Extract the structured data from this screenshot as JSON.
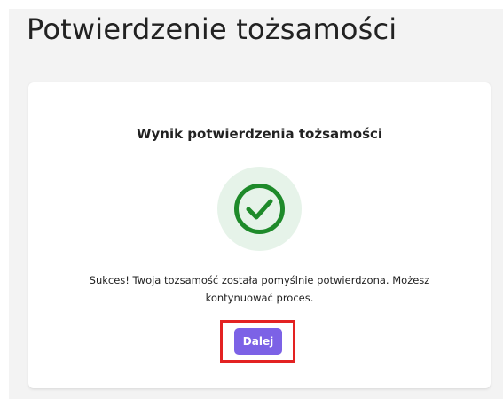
{
  "page": {
    "title": "Potwierdzenie tożsamości"
  },
  "card": {
    "title": "Wynik potwierdzenia tożsamości",
    "status_icon": "check-circle-icon",
    "message": "Sukces! Twoja tożsamość została pomyślnie potwierdzona. Możesz kontynuować proces.",
    "next_button_label": "Dalej"
  },
  "colors": {
    "success_green": "#1e8a2a",
    "success_circle_bg": "#e6f3e9",
    "button_purple": "#7c62e6",
    "highlight_red": "#e32222"
  }
}
